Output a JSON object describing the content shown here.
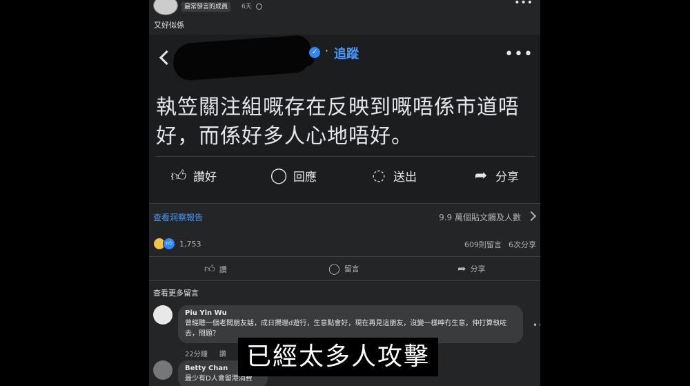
{
  "post": {
    "badge": "最常發言的成員",
    "time": "6天",
    "text": "又好似係"
  },
  "embed": {
    "follow_label": "追蹤",
    "quote": "執笠關注組嘅存在反映到嘅唔係市道唔好，而係好多人心地唔好。",
    "actions": {
      "like": "讚好",
      "comment": "回應",
      "send": "送出",
      "share": "分享"
    }
  },
  "insights": {
    "link": "查看洞察報告",
    "reach": "9.9 萬個貼文觸及人數"
  },
  "reactions": {
    "count": "1,753",
    "comments": "609則留言",
    "shares": "6次分享"
  },
  "actions": {
    "like": "讚",
    "comment": "留言",
    "share": "分享"
  },
  "comments_section": {
    "more_label": "查看更多留言",
    "items": [
      {
        "name": "Piu Yin Wu",
        "body": "曾經聽一個老闆朋友話，成日攪理d遊行，生意點會好，現在再見這朋友，沒變一樣呻冇生意，仲打算執咗去，問題？",
        "time": "22分鐘",
        "like": "讚",
        "reply": "回覆"
      },
      {
        "name": "Betty Chan",
        "body": "最少有D人會留港消費"
      }
    ]
  },
  "subtitle": "已經太多人攻擊"
}
